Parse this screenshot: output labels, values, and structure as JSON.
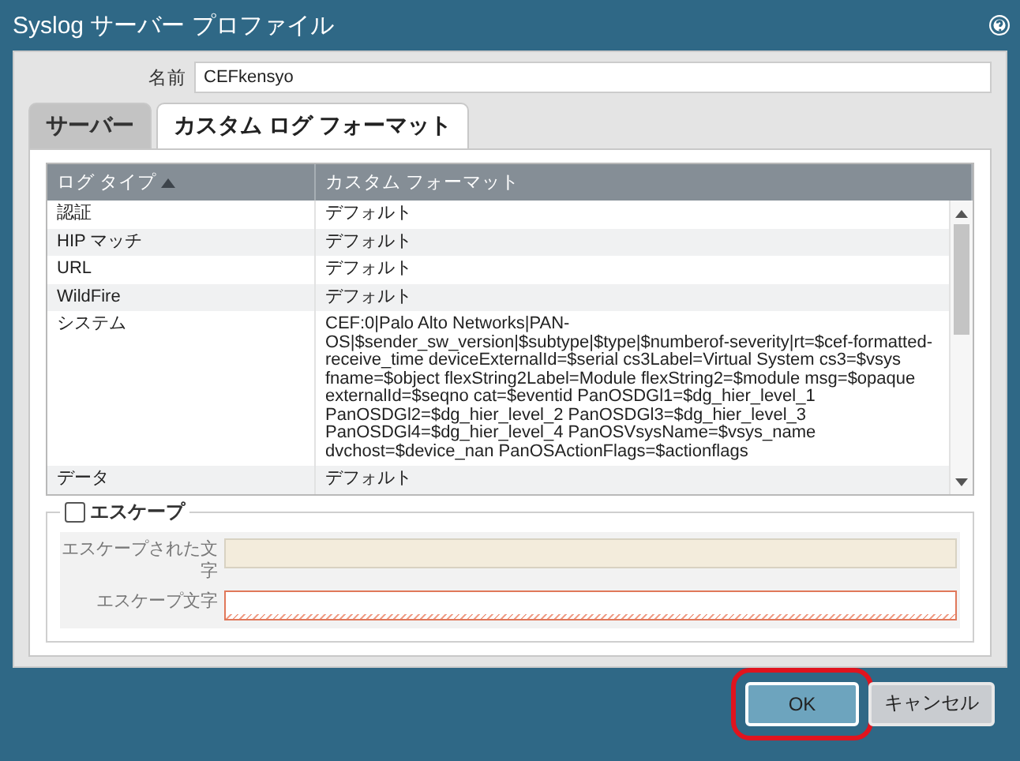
{
  "window": {
    "title": "Syslog サーバー プロファイル"
  },
  "name_field": {
    "label": "名前",
    "value": "CEFkensyo"
  },
  "tabs": [
    {
      "label": "サーバー",
      "selected": false
    },
    {
      "label": "カスタム ログ フォーマット",
      "selected": true
    }
  ],
  "table": {
    "columns": [
      {
        "label": "ログ タイプ",
        "sorted": true
      },
      {
        "label": "カスタム フォーマット",
        "sorted": false
      }
    ],
    "rows": [
      {
        "log_type": "認証",
        "format": "デフォルト"
      },
      {
        "log_type": "HIP マッチ",
        "format": "デフォルト"
      },
      {
        "log_type": "URL",
        "format": "デフォルト"
      },
      {
        "log_type": "WildFire",
        "format": "デフォルト"
      },
      {
        "log_type": "システム",
        "format": "CEF:0|Palo Alto Networks|PAN-OS|$sender_sw_version|$subtype|$type|$numberof-severity|rt=$cef-formatted-receive_time deviceExternalId=$serial cs3Label=Virtual System cs3=$vsys fname=$object flexString2Label=Module flexString2=$module msg=$opaque externalId=$seqno cat=$eventid PanOSDGl1=$dg_hier_level_1 PanOSDGl2=$dg_hier_level_2 PanOSDGl3=$dg_hier_level_3 PanOSDGl4=$dg_hier_level_4 PanOSVsysName=$vsys_name dvchost=$device_nan PanOSActionFlags=$actionflags"
      },
      {
        "log_type": "データ",
        "format": "デフォルト"
      }
    ]
  },
  "escape": {
    "label": "エスケープ",
    "checked": false,
    "fields": [
      {
        "label": "エスケープされた文字",
        "kind": "disabled"
      },
      {
        "label": "エスケープ文字",
        "kind": "invalid"
      }
    ]
  },
  "buttons": [
    {
      "label": "OK",
      "kind": "primary",
      "highlighted": true
    },
    {
      "label": "キャンセル",
      "kind": "secondary",
      "highlighted": false
    }
  ]
}
